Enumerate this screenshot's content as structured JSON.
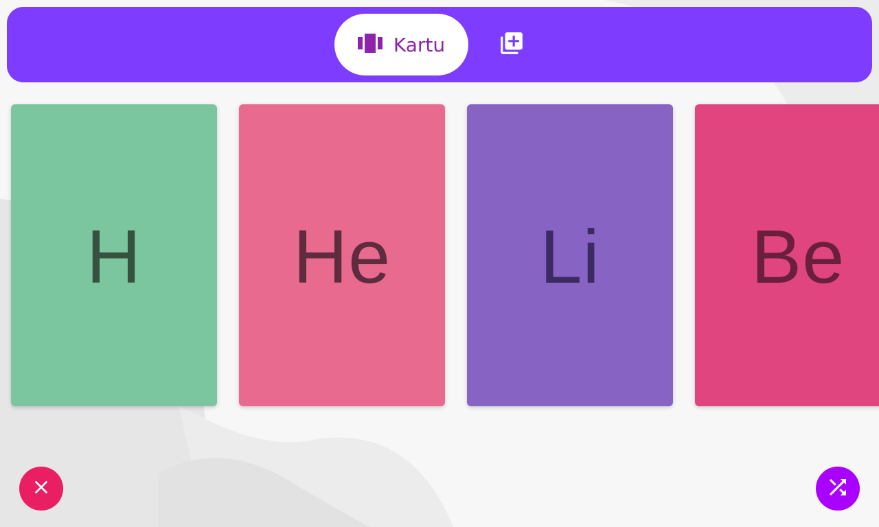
{
  "colors": {
    "topbar": "#7d3cff",
    "tab_active_icon": "#8e24aa",
    "tab_active_text": "#8e24aa",
    "add_icon": "#ffffff",
    "close_fab": "#e91e63",
    "shuffle_fab": "#aa00ff"
  },
  "topbar": {
    "tabs": [
      {
        "label": "Kartu",
        "icon": "view-carousel-icon",
        "active": true
      },
      {
        "label": "",
        "icon": "library-add-icon",
        "active": false
      }
    ]
  },
  "cards": [
    {
      "symbol": "H",
      "bg": "#7bc69e",
      "fg": "#36513f"
    },
    {
      "symbol": "He",
      "bg": "#e86b8f",
      "fg": "#5e2c3e"
    },
    {
      "symbol": "Li",
      "bg": "#8763c4",
      "fg": "#3c2a63"
    },
    {
      "symbol": "Be",
      "bg": "#e0457f",
      "fg": "#6a1f3d"
    }
  ],
  "fabs": {
    "close": {
      "icon": "close-icon"
    },
    "shuffle": {
      "icon": "shuffle-icon"
    }
  }
}
